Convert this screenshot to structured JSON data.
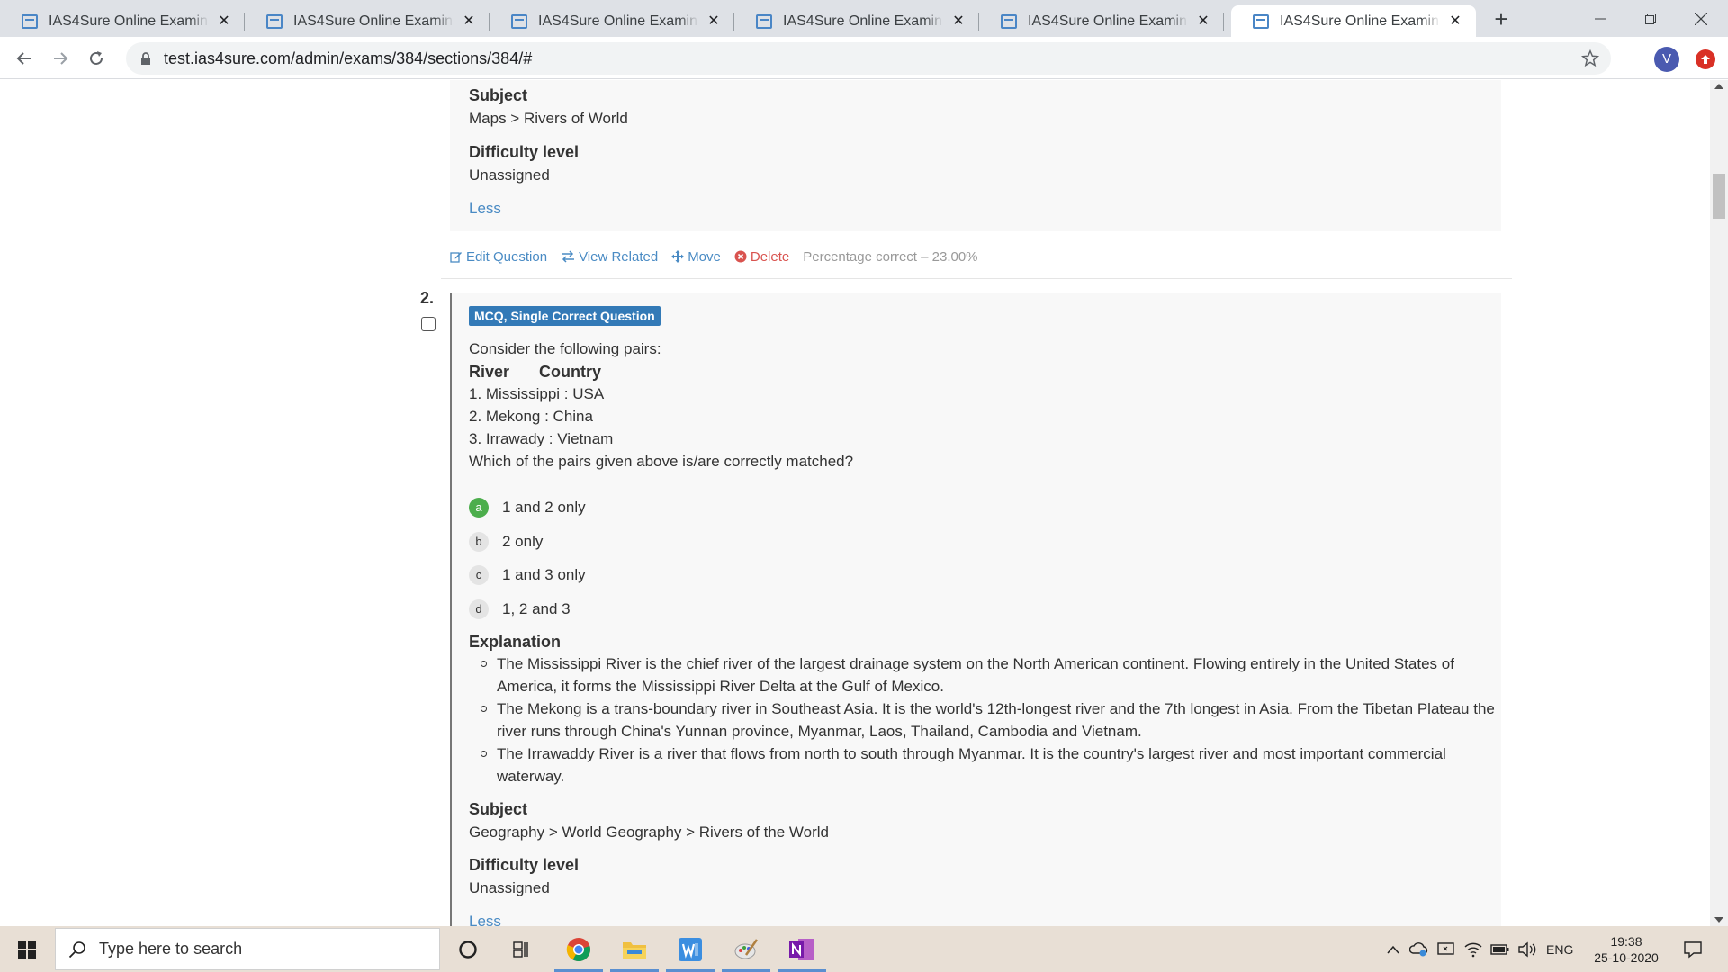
{
  "browser": {
    "tabs": [
      {
        "title": "IAS4Sure Online Examination"
      },
      {
        "title": "IAS4Sure Online Examination"
      },
      {
        "title": "IAS4Sure Online Examination"
      },
      {
        "title": "IAS4Sure Online Examination"
      },
      {
        "title": "IAS4Sure Online Examination"
      },
      {
        "title": "IAS4Sure Online Examination",
        "active": true
      }
    ],
    "url": "test.ias4sure.com/admin/exams/384/sections/384/#",
    "profile_initial": "V"
  },
  "question1": {
    "subject_label": "Subject",
    "subject_value": "Maps > Rivers of World",
    "difficulty_label": "Difficulty level",
    "difficulty_value": "Unassigned",
    "less_link": "Less",
    "actions": {
      "edit": "Edit Question",
      "view_related": "View Related",
      "move": "Move",
      "delete": "Delete",
      "percentage": "Percentage correct – 23.00%"
    }
  },
  "question2": {
    "number": "2.",
    "type_badge": "MCQ, Single Correct Question",
    "stem_intro": "Consider the following pairs:",
    "col_river": "River",
    "col_country": "Country",
    "pairs": [
      "1. Mississippi : USA",
      "2. Mekong : China",
      "3. Irrawady : Vietnam"
    ],
    "prompt": "Which of the pairs given above is/are correctly matched?",
    "options": [
      {
        "letter": "a",
        "text": "1 and 2 only",
        "correct": true
      },
      {
        "letter": "b",
        "text": "2 only"
      },
      {
        "letter": "c",
        "text": "1 and 3 only"
      },
      {
        "letter": "d",
        "text": "1, 2 and 3"
      }
    ],
    "correct_color": "#4cae4c",
    "explanation_label": "Explanation",
    "explanation": [
      "The Mississippi River is the chief river of the largest drainage system on the North American continent. Flowing entirely in the United States of America, it forms the Mississippi River Delta at the Gulf of Mexico.",
      "The Mekong is a trans-boundary river in Southeast Asia. It is the world's 12th-longest river and the 7th longest in Asia. From the Tibetan Plateau the river runs through China's Yunnan province, Myanmar, Laos, Thailand, Cambodia and Vietnam.",
      "The Irrawaddy River is a river that flows from north to south through Myanmar. It is the country's largest river and most important commercial waterway."
    ],
    "subject_label": "Subject",
    "subject_value": "Geography > World Geography > Rivers of the World",
    "difficulty_label": "Difficulty level",
    "difficulty_value": "Unassigned",
    "less_link": "Less"
  },
  "taskbar": {
    "search_placeholder": "Type here to search",
    "language": "ENG",
    "time": "19:38",
    "date": "25-10-2020"
  }
}
